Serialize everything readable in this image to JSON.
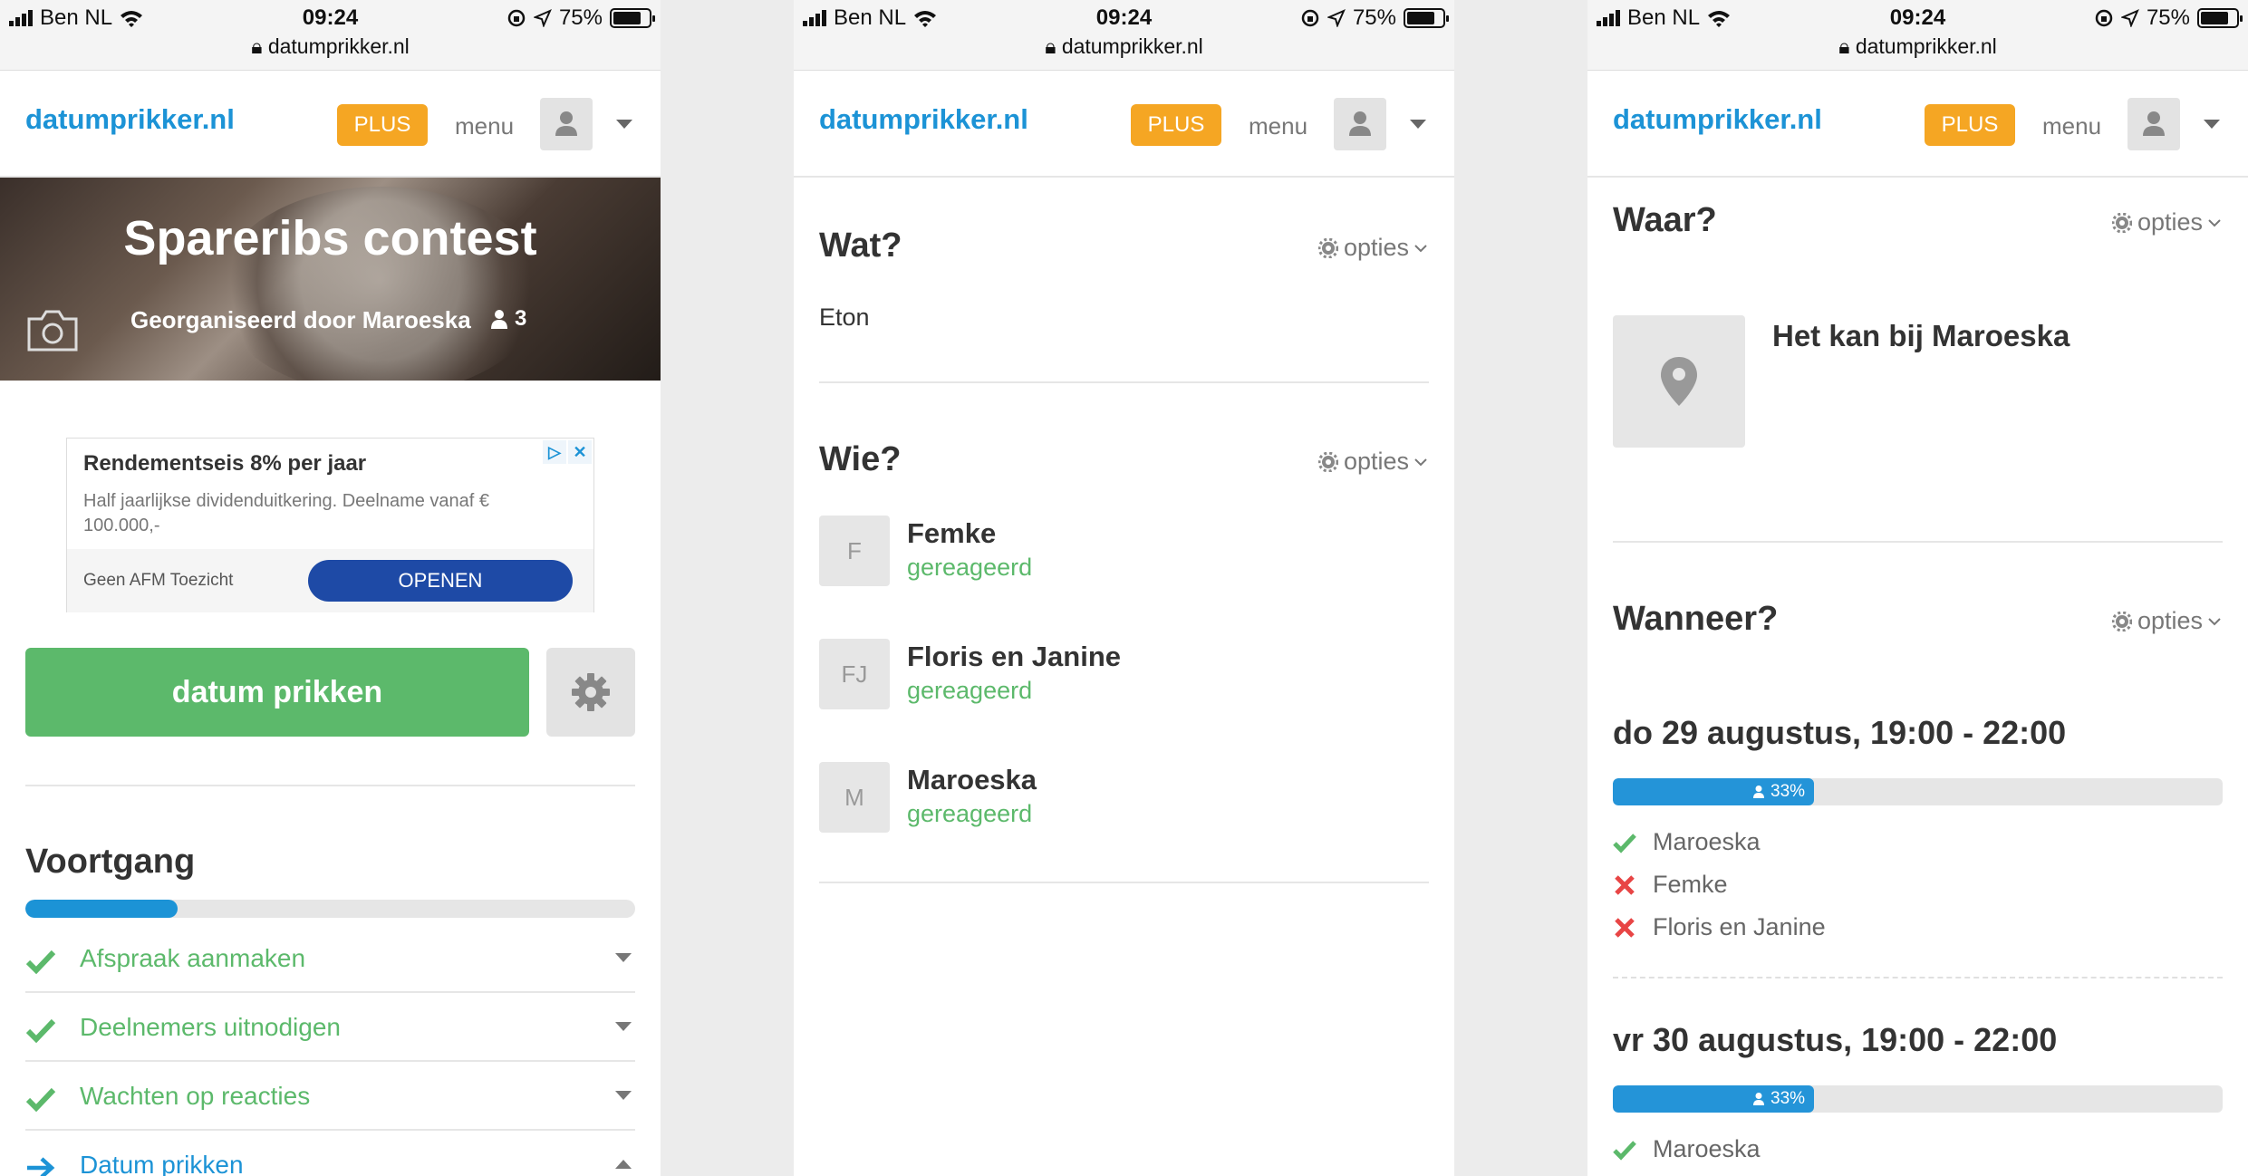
{
  "status": {
    "carrier": "Ben NL",
    "time": "09:24",
    "battery": "75%",
    "url": "datumprikker.nl"
  },
  "nav": {
    "logo": "datumprikker.nl",
    "plus": "PLUS",
    "menu": "menu"
  },
  "screen1": {
    "hero_title": "Spareribs contest",
    "organizer": "Georganiseerd door Maroeska",
    "participants": "3",
    "ad": {
      "title": "Rendementseis 8% per jaar",
      "desc": "Half jaarlijkse dividenduitkering. Deelname vanaf € 100.000,-",
      "note": "Geen AFM Toezicht",
      "button": "OPENEN"
    },
    "main_button": "datum prikken",
    "progress_title": "Voortgang",
    "progress_fraction": 0.25,
    "steps": [
      {
        "label": "Afspraak aanmaken",
        "state": "done"
      },
      {
        "label": "Deelnemers uitnodigen",
        "state": "done"
      },
      {
        "label": "Wachten op reacties",
        "state": "done"
      },
      {
        "label": "Datum prikken",
        "state": "current"
      }
    ]
  },
  "screen2": {
    "wat_title": "Wat?",
    "opties": "opties",
    "wat_value": "Eton",
    "wie_title": "Wie?",
    "people": [
      {
        "initials": "F",
        "name": "Femke",
        "status": "gereageerd"
      },
      {
        "initials": "FJ",
        "name": "Floris en Janine",
        "status": "gereageerd"
      },
      {
        "initials": "M",
        "name": "Maroeska",
        "status": "gereageerd"
      }
    ]
  },
  "screen3": {
    "waar_title": "Waar?",
    "opties": "opties",
    "location": "Het kan bij Maroeska",
    "wanneer_title": "Wanneer?",
    "dates": [
      {
        "label": "do 29 augustus, 19:00 - 22:00",
        "percent": "33%",
        "fraction": 0.33,
        "votes": [
          {
            "name": "Maroeska",
            "vote": "yes"
          },
          {
            "name": "Femke",
            "vote": "no"
          },
          {
            "name": "Floris en Janine",
            "vote": "no"
          }
        ]
      },
      {
        "label": "vr 30 augustus, 19:00 - 22:00",
        "percent": "33%",
        "fraction": 0.33,
        "votes": [
          {
            "name": "Maroeska",
            "vote": "yes"
          }
        ]
      }
    ]
  },
  "colors": {
    "brand_blue": "#1c93d6",
    "green": "#5cb96b",
    "orange": "#f5a623",
    "red": "#e84545"
  }
}
